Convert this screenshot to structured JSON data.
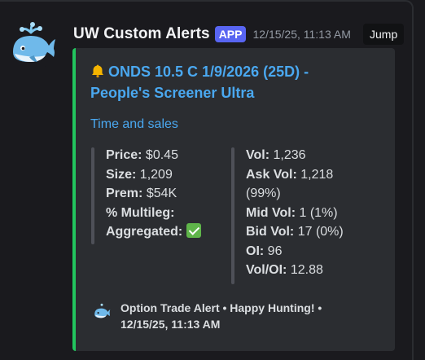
{
  "message": {
    "author": "UW Custom Alerts",
    "badge": "APP",
    "timestamp": "12/15/25, 11:13 AM",
    "jump_label": "Jump"
  },
  "embed": {
    "accent_color": "#22c55e",
    "title_icon": "bell-icon",
    "title_line1": "ONDS 10.5 C 1/9/2026 (25D) -",
    "title_line2": "People's Screener Ultra",
    "description": "Time and sales",
    "left_field": [
      {
        "label": "Price:",
        "value": "$0.45"
      },
      {
        "label": "Size:",
        "value": "1,209"
      },
      {
        "label": "Prem:",
        "value": "$54K"
      },
      {
        "label": "% Multileg:",
        "value": ""
      },
      {
        "label": "Aggregated:",
        "value": "check-mark-emoji"
      }
    ],
    "right_field": {
      "vol_label": "Vol:",
      "vol_value": "1,236",
      "ask_label": "Ask Vol:",
      "ask_value": "1,218",
      "ask_pct": "(99%)",
      "mid_label": "Mid Vol:",
      "mid_value": "1 (1%)",
      "bid_label": "Bid Vol:",
      "bid_value": "17 (0%)",
      "oi_label": "OI:",
      "oi_value": "96",
      "voloi_label": "Vol/OI:",
      "voloi_value": "12.88"
    },
    "footer": {
      "text_line1": "Option Trade Alert • Happy Hunting! •",
      "text_line2": "12/15/25, 11:13 AM"
    }
  },
  "colors": {
    "background": "#1a1a1e",
    "embed_background": "#2b2d31",
    "link_blue": "#4aa8f0",
    "badge_blurple": "#5865f2"
  }
}
